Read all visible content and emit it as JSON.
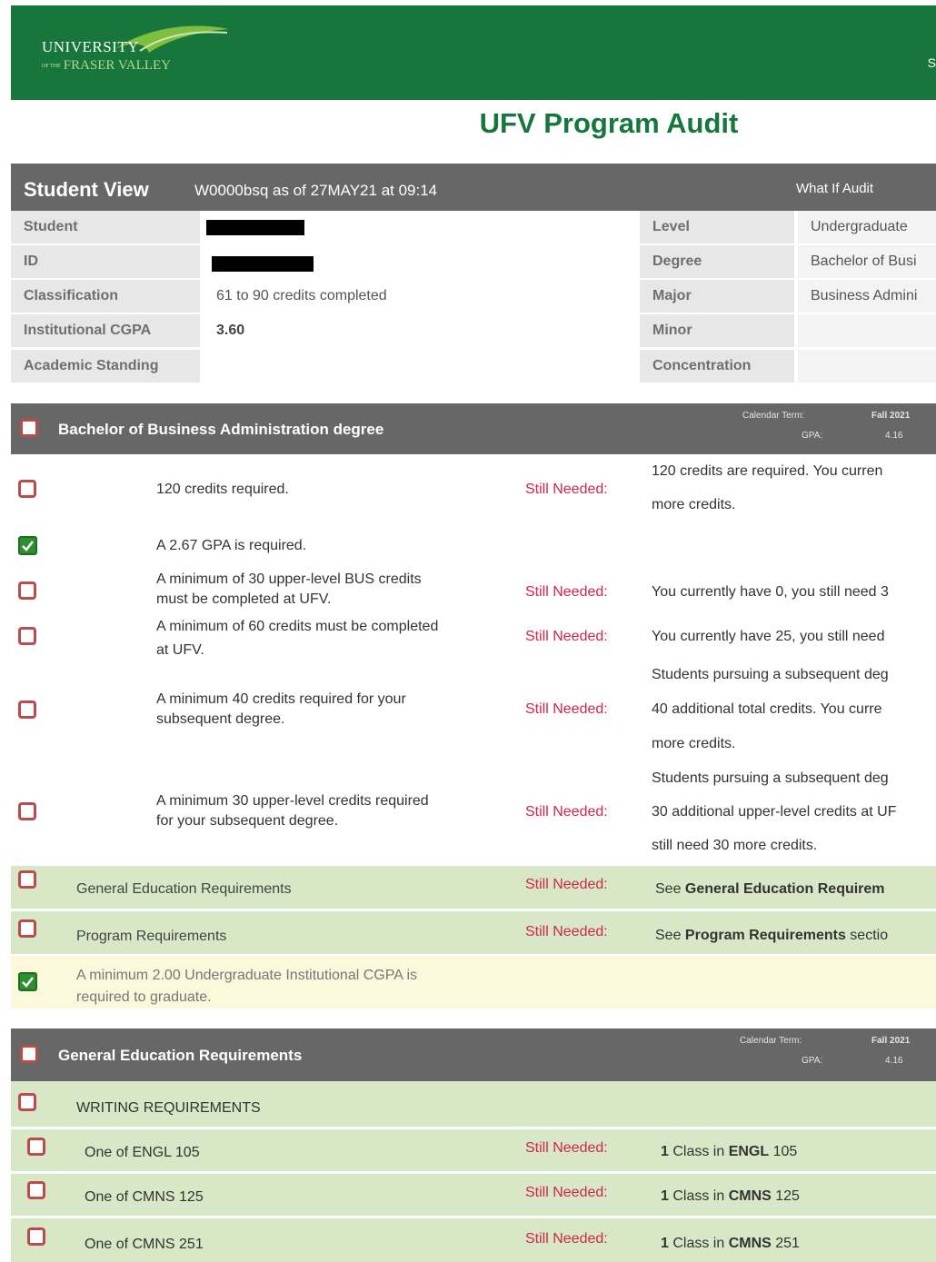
{
  "header": {
    "logo_line1": "UNIVERSITY",
    "logo_ofthe": "OF THE",
    "logo_line2": "FRASER VALLEY",
    "cut_text": "S"
  },
  "page_title": "UFV Program Audit",
  "student_view": {
    "title": "Student View",
    "subtitle": "W0000bsq as of 27MAY21 at 09:14",
    "what_if": "What If Audit",
    "rows": [
      {
        "label": "Student",
        "value": "",
        "label2": "Level",
        "value2": "Undergraduate"
      },
      {
        "label": "ID",
        "value": "",
        "label2": "Degree",
        "value2": "Bachelor of Busi"
      },
      {
        "label": "Classification",
        "value": "61 to 90 credits completed",
        "label2": "Major",
        "value2": "Business Admini"
      },
      {
        "label": "Institutional CGPA",
        "value": "3.60",
        "label2": "Minor",
        "value2": ""
      },
      {
        "label": "Academic Standing",
        "value": "",
        "label2": "Concentration",
        "value2": ""
      }
    ]
  },
  "degree_block": {
    "title": "Bachelor of Business Administration degree",
    "calendar_term_label": "Calendar Term:",
    "calendar_term_value": "Fall 2021",
    "gpa_label": "GPA:",
    "gpa_value": "4.16",
    "still_needed": "Still Needed:",
    "items": [
      {
        "text": "120 credits required.",
        "r1": "120 credits are required. You curren",
        "r2": "more credits."
      },
      {
        "text": "A 2.67 GPA is required."
      },
      {
        "text1": "A minimum of 30 upper-level BUS credits",
        "text2": "must be completed at UFV.",
        "r1": "You currently have 0, you still need 3"
      },
      {
        "text1": "A minimum of 60 credits must be completed",
        "text2": "at UFV.",
        "r1": "You currently have 25, you still need"
      },
      {
        "text1": "A minimum 40 credits required for your",
        "text2": "subsequent degree.",
        "r1": "Students pursuing a subsequent deg",
        "r2": "40 additional total credits. You curre",
        "r3": "more credits."
      },
      {
        "text1": "A minimum 30 upper-level credits required",
        "text2": "for your subsequent degree.",
        "r1": "Students pursuing a subsequent deg",
        "r2": "30 additional upper-level credits at UF",
        "r3": "still need 30 more credits."
      }
    ],
    "ge_row": {
      "text": "General Education Requirements",
      "pre": "See ",
      "bold": "General Education Requirem"
    },
    "prog_row": {
      "text": "Program Requirements",
      "pre": "See ",
      "bold": "Program Requirements",
      "post": " sectio"
    },
    "cgpa_row": {
      "text1": "A minimum 2.00 Undergraduate Institutional CGPA is",
      "text2": "required to graduate."
    }
  },
  "ge_block": {
    "title": "General Education Requirements",
    "calendar_term_label": "Calendar Term:",
    "calendar_term_value": "Fall 2021",
    "gpa_label": "GPA:",
    "gpa_value": "4.16",
    "writing": "WRITING REQUIREMENTS",
    "still_needed": "Still Needed:",
    "courses": [
      {
        "text": "One of ENGL 105",
        "count": "1",
        "cls": " Class in ",
        "subj": "ENGL",
        "num": " 105"
      },
      {
        "text": "One of CMNS 125",
        "count": "1",
        "cls": " Class in ",
        "subj": "CMNS",
        "num": " 125"
      },
      {
        "text": "One of CMNS 251",
        "count": "1",
        "cls": " Class in ",
        "subj": "CMNS",
        "num": " 251"
      }
    ]
  }
}
